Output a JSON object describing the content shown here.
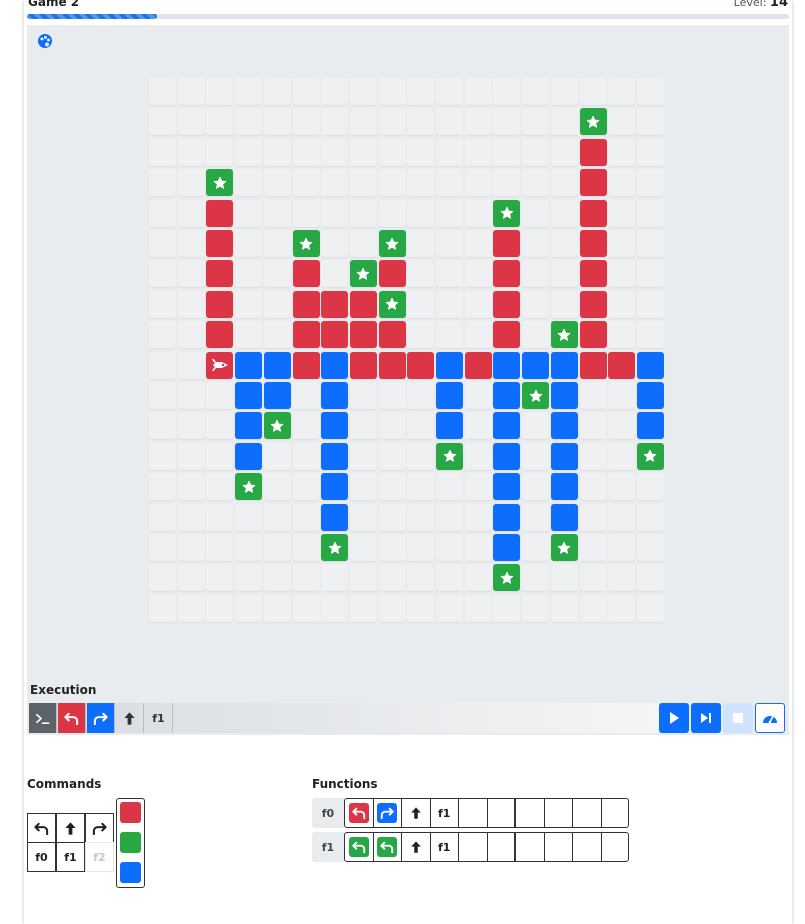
{
  "header": {
    "title": "Game 2",
    "level_label": "Level:",
    "level_value": "14",
    "progress_fraction": 0.17
  },
  "colors": {
    "red": "#dc3545",
    "green": "#28a745",
    "blue": "#0d6efd",
    "empty": "#eef0f2",
    "board_bg": "#e9ecef"
  },
  "board": {
    "rows": [
      "..................",
      "...............*..",
      "...............R..",
      "..*............R..",
      "..R.........*..R..",
      "..R..*..*...R..R..",
      "..R..R.*R...R..R..",
      "..R..RRR*...R..R..",
      "..R..RRRR...R.*R..",
      "..PBBRBRRRBRBBBRRB",
      "...BB.B...B.B*B..B",
      "...B*.B...B.B.B..B",
      "...B..B...*.B.B..*",
      "...*..B.....B.B...",
      "......B.....B.B...",
      "......*.....B.*...",
      "............*.....",
      ".................."
    ],
    "legend": {
      ".": "empty",
      "R": "red",
      "G": "green",
      "B": "blue",
      "*": "star on green",
      "P": "player on red"
    },
    "player_direction": "right"
  },
  "execution": {
    "label": "Execution",
    "slots": [
      {
        "icon": "terminal-icon",
        "bg": "#5c636a",
        "text": ""
      },
      {
        "icon": "turn-left-icon",
        "bg": "#dc3545",
        "text": ""
      },
      {
        "icon": "turn-right-icon",
        "bg": "#0d6efd",
        "text": ""
      },
      {
        "icon": "forward-arrow-icon",
        "bg": "",
        "text": ""
      },
      {
        "icon": "",
        "bg": "",
        "text": "f1"
      }
    ],
    "buttons": [
      "play-icon",
      "step-forward-icon",
      "stop-icon",
      "speedometer-icon"
    ]
  },
  "commands": {
    "label": "Commands",
    "row1": [
      "turn-left-icon",
      "forward-arrow-icon",
      "turn-right-icon"
    ],
    "row2": [
      "f0",
      "f1",
      "f2"
    ]
  },
  "functions": {
    "label": "Functions",
    "list": [
      {
        "name": "f0",
        "slots": [
          {
            "icon": "turn-left-icon",
            "bg": "#dc3545",
            "text": ""
          },
          {
            "icon": "turn-right-icon",
            "bg": "#0d6efd",
            "text": ""
          },
          {
            "icon": "forward-arrow-icon",
            "bg": "",
            "text": ""
          },
          {
            "icon": "",
            "bg": "",
            "text": "f1"
          },
          {
            "icon": "",
            "bg": "",
            "text": ""
          },
          {
            "icon": "",
            "bg": "",
            "text": ""
          },
          {
            "icon": "",
            "bg": "",
            "text": ""
          },
          {
            "icon": "",
            "bg": "",
            "text": ""
          },
          {
            "icon": "",
            "bg": "",
            "text": ""
          },
          {
            "icon": "",
            "bg": "",
            "text": ""
          }
        ]
      },
      {
        "name": "f1",
        "slots": [
          {
            "icon": "turn-left-icon",
            "bg": "#28a745",
            "text": ""
          },
          {
            "icon": "turn-left-icon",
            "bg": "#28a745",
            "text": ""
          },
          {
            "icon": "forward-arrow-icon",
            "bg": "",
            "text": ""
          },
          {
            "icon": "",
            "bg": "",
            "text": "f1"
          },
          {
            "icon": "",
            "bg": "",
            "text": ""
          },
          {
            "icon": "",
            "bg": "",
            "text": ""
          },
          {
            "icon": "",
            "bg": "",
            "text": ""
          },
          {
            "icon": "",
            "bg": "",
            "text": ""
          },
          {
            "icon": "",
            "bg": "",
            "text": ""
          },
          {
            "icon": "",
            "bg": "",
            "text": ""
          }
        ]
      }
    ]
  }
}
